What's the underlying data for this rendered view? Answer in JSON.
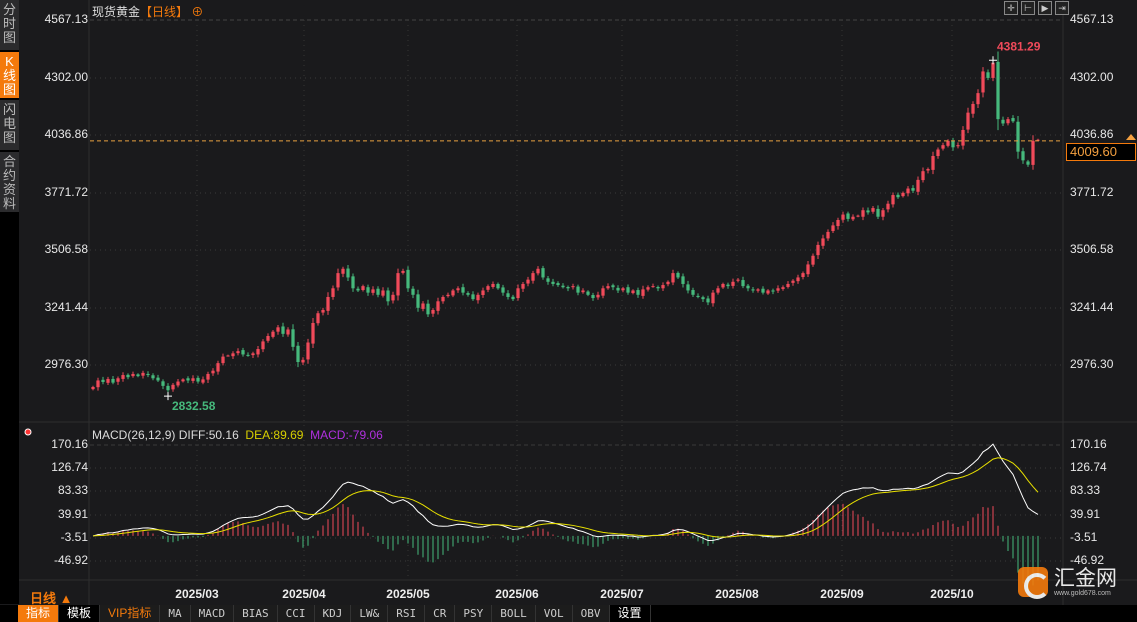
{
  "sidebar": {
    "tabs": [
      {
        "label": "分时图",
        "active": false
      },
      {
        "label": "K线图",
        "active": true
      },
      {
        "label": "闪电图",
        "active": false
      },
      {
        "label": "合约资料",
        "active": false
      }
    ]
  },
  "header": {
    "instrument": "现货黄金",
    "period": "【日线】",
    "add_icon": "circle-plus-icon"
  },
  "toolbar": {
    "icons": [
      "crosshair-icon",
      "zoom-left-icon",
      "play-right-icon",
      "jump-end-icon"
    ]
  },
  "colors": {
    "up": "#f04a5a",
    "down": "#46b97c",
    "accent": "#f47a0c",
    "diff": "#ffffff",
    "dea": "#e8e000",
    "macd": "#b030e0"
  },
  "price_axis": {
    "ticks": [
      "4567.13",
      "4302.00",
      "4036.86",
      "3771.72",
      "3506.58",
      "3241.44",
      "2976.30"
    ],
    "current": "4009.60"
  },
  "annotations": {
    "max": {
      "label": "4381.29",
      "value": 4381.29,
      "index": 180
    },
    "min": {
      "label": "2832.58",
      "value": 2832.58,
      "index": 15
    }
  },
  "macd": {
    "legend": {
      "name": "MACD(26,12,9)",
      "diff": "DIFF:50.16",
      "dea": "DEA:89.69",
      "macd": "MACD:-79.06"
    },
    "ticks": [
      "170.16",
      "126.74",
      "83.33",
      "39.91",
      "-3.51",
      "-46.92"
    ]
  },
  "time_axis": {
    "months": [
      "2025/03",
      "2025/04",
      "2025/05",
      "2025/06",
      "2025/07",
      "2025/08",
      "2025/09",
      "2025/10"
    ]
  },
  "period_selector": "日线 ▲",
  "bottom_tabs": [
    "指标",
    "模板",
    "VIP指标",
    "MA",
    "MACD",
    "BIAS",
    "CCI",
    "KDJ",
    "LW&",
    "RSI",
    "CR",
    "PSY",
    "BOLL",
    "VOL",
    "OBV",
    "设置"
  ],
  "logo": {
    "name": "汇金网",
    "url": "www.gold678.com"
  },
  "chart_data": {
    "type": "candlestick",
    "title": "现货黄金【日线】",
    "ylim": [
      2976.3,
      4567.13
    ],
    "closes": [
      2875,
      2905,
      2898,
      2912,
      2895,
      2915,
      2930,
      2920,
      2935,
      2925,
      2940,
      2930,
      2915,
      2905,
      2880,
      2860,
      2885,
      2900,
      2910,
      2905,
      2915,
      2900,
      2910,
      2935,
      2950,
      2985,
      3015,
      3020,
      3030,
      3040,
      3025,
      3020,
      3030,
      3050,
      3085,
      3110,
      3130,
      3150,
      3120,
      3140,
      3060,
      2990,
      3000,
      3080,
      3170,
      3215,
      3230,
      3290,
      3330,
      3400,
      3420,
      3380,
      3330,
      3320,
      3340,
      3310,
      3325,
      3300,
      3320,
      3270,
      3300,
      3400,
      3410,
      3330,
      3300,
      3240,
      3260,
      3210,
      3230,
      3270,
      3290,
      3300,
      3320,
      3330,
      3310,
      3300,
      3280,
      3300,
      3320,
      3340,
      3350,
      3330,
      3310,
      3290,
      3280,
      3330,
      3350,
      3370,
      3400,
      3420,
      3380,
      3360,
      3350,
      3345,
      3335,
      3330,
      3340,
      3310,
      3320,
      3300,
      3285,
      3300,
      3330,
      3340,
      3335,
      3320,
      3330,
      3310,
      3320,
      3300,
      3325,
      3335,
      3340,
      3330,
      3345,
      3360,
      3400,
      3380,
      3350,
      3320,
      3300,
      3290,
      3280,
      3265,
      3310,
      3330,
      3350,
      3340,
      3360,
      3370,
      3340,
      3330,
      3320,
      3325,
      3310,
      3320,
      3315,
      3330,
      3335,
      3350,
      3365,
      3380,
      3400,
      3440,
      3480,
      3530,
      3560,
      3590,
      3620,
      3645,
      3670,
      3650,
      3660,
      3665,
      3690,
      3680,
      3700,
      3660,
      3690,
      3720,
      3760,
      3750,
      3770,
      3790,
      3780,
      3830,
      3870,
      3880,
      3940,
      3970,
      3990,
      4010,
      3980,
      3990,
      4060,
      4140,
      4180,
      4230,
      4330,
      4300,
      4370,
      4110,
      4090,
      4110,
      4100,
      3960,
      3920,
      3900,
      4010,
      4015
    ]
  }
}
